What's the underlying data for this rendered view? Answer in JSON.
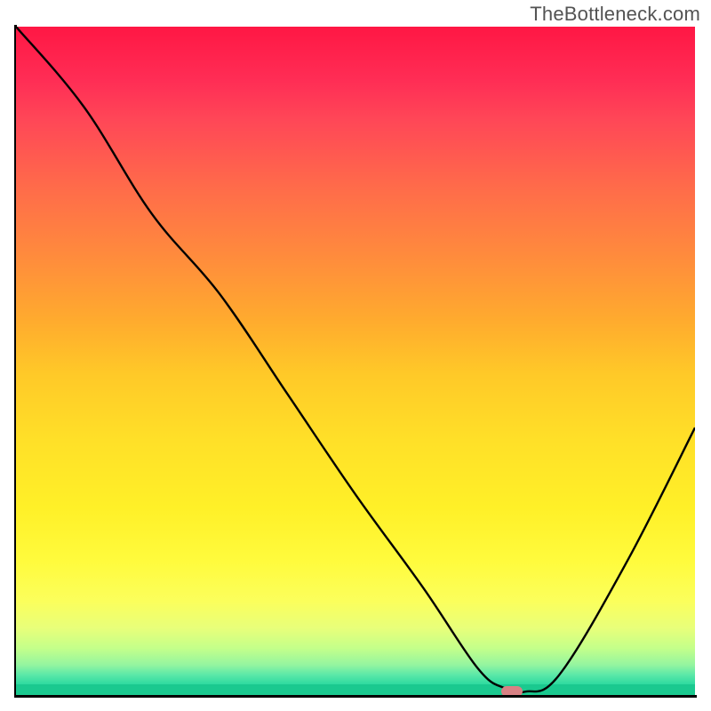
{
  "watermark": "TheBottleneck.com",
  "chart_data": {
    "type": "line",
    "title": "",
    "xlabel": "",
    "ylabel": "",
    "xlim": [
      0,
      100
    ],
    "ylim": [
      0,
      100
    ],
    "x": [
      0,
      10,
      20,
      30,
      40,
      50,
      60,
      68,
      72,
      75,
      80,
      90,
      100
    ],
    "values": [
      100,
      88,
      72,
      60,
      45,
      30,
      16,
      4,
      1,
      0.5,
      3,
      20,
      40
    ],
    "marker": {
      "x": 73,
      "y": 0.5
    },
    "background_gradient": {
      "type": "vertical",
      "stops": [
        {
          "pos": 0.0,
          "color": "#ff1744"
        },
        {
          "pos": 0.5,
          "color": "#ffd028"
        },
        {
          "pos": 0.85,
          "color": "#fffb3d"
        },
        {
          "pos": 1.0,
          "color": "#1ac98f"
        }
      ]
    }
  }
}
